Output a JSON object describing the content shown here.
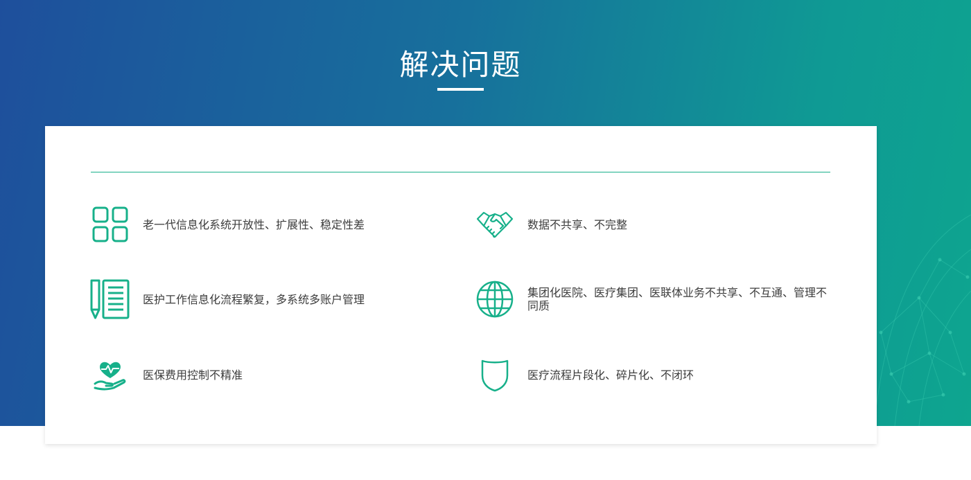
{
  "section": {
    "title": "解决问题"
  },
  "colors": {
    "accent": "#17b08a",
    "banner_start": "#1e4f9c",
    "banner_end": "#0ea58f",
    "text": "#3c3c3c"
  },
  "problems": [
    {
      "icon": "grid-icon",
      "text": "老一代信息化系统开放性、扩展性、稳定性差"
    },
    {
      "icon": "handshake-icon",
      "text": "数据不共享、不完整"
    },
    {
      "icon": "document-pen-icon",
      "text": "医护工作信息化流程繁复，多系统多账户管理"
    },
    {
      "icon": "globe-icon",
      "text": "集团化医院、医疗集团、医联体业务不共享、不互通、管理不同质"
    },
    {
      "icon": "heart-hand-icon",
      "text": "医保费用控制不精准"
    },
    {
      "icon": "shield-icon",
      "text": "医疗流程片段化、碎片化、不闭环"
    }
  ]
}
